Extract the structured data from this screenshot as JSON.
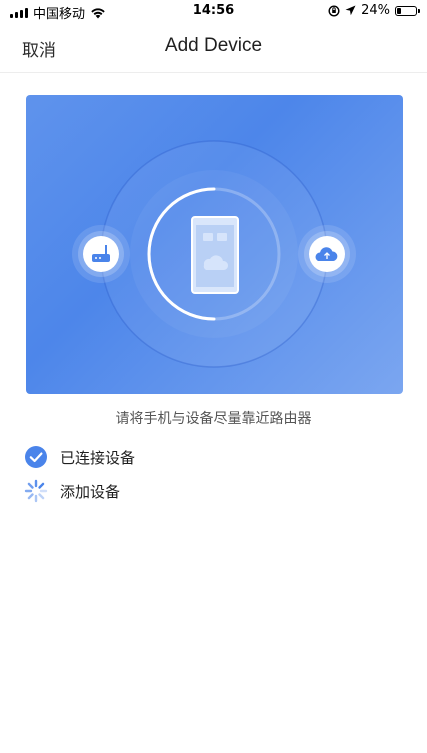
{
  "status_bar": {
    "carrier": "中国移动",
    "time": "14:56",
    "battery": "24%",
    "battery_level": 0.24
  },
  "nav": {
    "cancel_label": "取消",
    "title": "Add Device"
  },
  "illustration": {
    "left_icon": "router-icon",
    "center_icon": "phone-icon",
    "right_icon": "cloud-upload-icon",
    "progress_ring": "spinner-arc"
  },
  "hint_text": "请将手机与设备尽量靠近路由器",
  "steps": [
    {
      "label": "已连接设备",
      "icon": "check-circle-icon",
      "status": "done"
    },
    {
      "label": "添加设备",
      "icon": "loading-spinner-icon",
      "status": "in-progress"
    }
  ],
  "colors": {
    "accent": "#4a84ea",
    "card_gradient_start": "#5f93ec",
    "card_gradient_end": "#7ba6f0"
  }
}
